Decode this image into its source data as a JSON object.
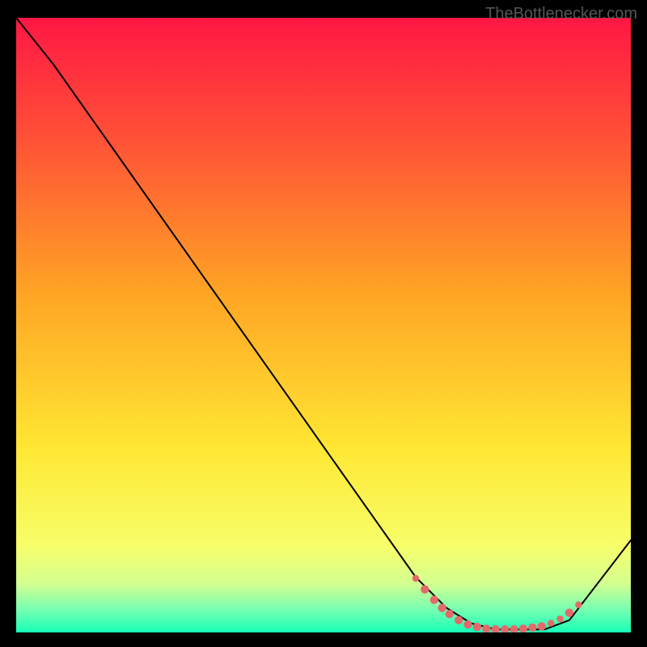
{
  "attribution": "TheBottlenecker.com",
  "chart_data": {
    "type": "line",
    "title": "",
    "xlabel": "",
    "ylabel": "",
    "xlim": [
      0,
      100
    ],
    "ylim": [
      0,
      100
    ],
    "background_gradient": {
      "stops": [
        {
          "offset": 0,
          "color": "#ff1744"
        },
        {
          "offset": 20,
          "color": "#ff5236"
        },
        {
          "offset": 45,
          "color": "#ffa524"
        },
        {
          "offset": 70,
          "color": "#ffe733"
        },
        {
          "offset": 86,
          "color": "#f7ff6a"
        },
        {
          "offset": 92,
          "color": "#d4ff90"
        },
        {
          "offset": 96,
          "color": "#7dffb0"
        },
        {
          "offset": 100,
          "color": "#17ffb8"
        }
      ]
    },
    "series": [
      {
        "name": "curve",
        "stroke": "#000000",
        "stroke_width": 2,
        "points": [
          {
            "x": 0,
            "y": 100
          },
          {
            "x": 6,
            "y": 92.5
          },
          {
            "x": 65,
            "y": 9
          },
          {
            "x": 70,
            "y": 4
          },
          {
            "x": 74,
            "y": 1.5
          },
          {
            "x": 78,
            "y": 0.5
          },
          {
            "x": 86,
            "y": 0.5
          },
          {
            "x": 90,
            "y": 2
          },
          {
            "x": 100,
            "y": 15
          }
        ]
      }
    ],
    "markers": {
      "name": "highlight-dots",
      "color": "#e36a6a",
      "radius_small": 4.2,
      "radius_large": 5.2,
      "points": [
        {
          "x": 65,
          "y": 8.8,
          "r": "small"
        },
        {
          "x": 66.5,
          "y": 7.0,
          "r": "large"
        },
        {
          "x": 68,
          "y": 5.3,
          "r": "large"
        },
        {
          "x": 69.3,
          "y": 4.0,
          "r": "large"
        },
        {
          "x": 70.5,
          "y": 3.0,
          "r": "large"
        },
        {
          "x": 72,
          "y": 2.0,
          "r": "large"
        },
        {
          "x": 73.5,
          "y": 1.3,
          "r": "large"
        },
        {
          "x": 75,
          "y": 0.9,
          "r": "large"
        },
        {
          "x": 76.5,
          "y": 0.6,
          "r": "large"
        },
        {
          "x": 78,
          "y": 0.5,
          "r": "large"
        },
        {
          "x": 79.5,
          "y": 0.5,
          "r": "large"
        },
        {
          "x": 81,
          "y": 0.5,
          "r": "large"
        },
        {
          "x": 82.5,
          "y": 0.6,
          "r": "large"
        },
        {
          "x": 84,
          "y": 0.8,
          "r": "large"
        },
        {
          "x": 85.5,
          "y": 1.0,
          "r": "large"
        },
        {
          "x": 87,
          "y": 1.5,
          "r": "small"
        },
        {
          "x": 88.5,
          "y": 2.2,
          "r": "small"
        },
        {
          "x": 90,
          "y": 3.2,
          "r": "large"
        },
        {
          "x": 91.5,
          "y": 4.5,
          "r": "small"
        }
      ]
    }
  }
}
